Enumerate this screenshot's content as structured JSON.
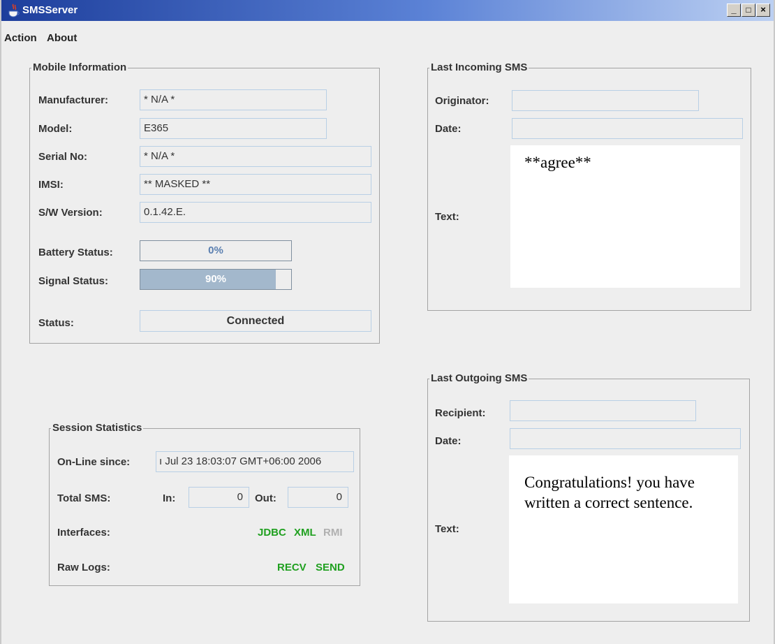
{
  "window": {
    "title": "SMSServer",
    "controls": {
      "minimize": "_",
      "maximize": "□",
      "close": "×"
    }
  },
  "menu": {
    "items": [
      "Action",
      "About"
    ]
  },
  "mobile": {
    "legend": "Mobile Information",
    "manufacturer_label": "Manufacturer:",
    "manufacturer": "* N/A *",
    "model_label": "Model:",
    "model": "E365",
    "serial_label": "Serial No:",
    "serial": "* N/A *",
    "imsi_label": "IMSI:",
    "imsi": "** MASKED **",
    "sw_label": "S/W Version:",
    "sw": "0.1.42.E.",
    "battery_label": "Battery Status:",
    "battery_text": "0%",
    "battery_level": 0,
    "signal_label": "Signal Status:",
    "signal_text": "90%",
    "signal_level": 0.9,
    "status_label": "Status:",
    "status": "Connected"
  },
  "incoming": {
    "legend": "Last Incoming SMS",
    "originator_label": "Originator:",
    "originator": "",
    "date_label": "Date:",
    "date": "",
    "text_label": "Text:",
    "text": "**agree**"
  },
  "outgoing": {
    "legend": "Last Outgoing SMS",
    "recipient_label": "Recipient:",
    "recipient": "",
    "date_label": "Date:",
    "date": "",
    "text_label": "Text:",
    "text": "Congratulations! you have written a  correct sentence."
  },
  "session": {
    "legend": "Session Statistics",
    "online_label": "On-Line since:",
    "online": "ı Jul 23 18:03:07 GMT+06:00 2006",
    "total_label": "Total SMS:",
    "in_label": "In:",
    "in": "0",
    "out_label": "Out:",
    "out": "0",
    "interfaces_label": "Interfaces:",
    "interfaces": {
      "jdbc": "JDBC",
      "xml": "XML",
      "rmi": "RMI"
    },
    "rawlogs_label": "Raw Logs:",
    "rawlogs": {
      "recv": "RECV",
      "send": "SEND"
    }
  },
  "colors": {
    "active_green": "#20a020",
    "inactive_grey": "#b0b0b0",
    "progress_fill": "#a3b8cc"
  }
}
